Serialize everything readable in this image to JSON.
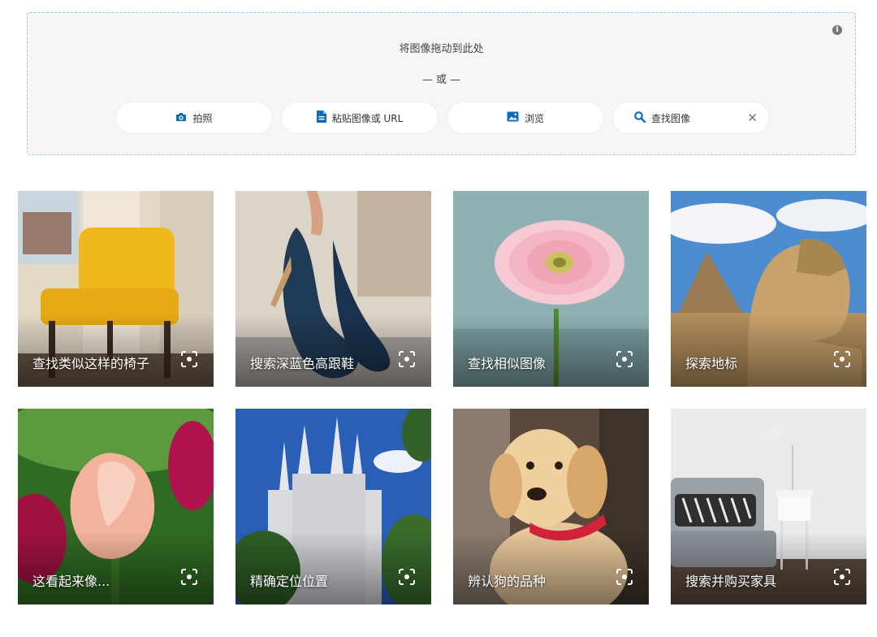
{
  "dropzone": {
    "title": "将图像拖动到此处",
    "or_text": "— 或 —",
    "buttons": {
      "camera": "拍照",
      "paste": "粘贴图像或 URL",
      "browse": "浏览",
      "search": "查找图像"
    },
    "close_glyph": "✕",
    "info_glyph": "i"
  },
  "examples": [
    {
      "caption": "查找类似这样的椅子"
    },
    {
      "caption": "搜索深蓝色高跟鞋"
    },
    {
      "caption": "查找相似图像"
    },
    {
      "caption": "探索地标"
    },
    {
      "caption": "这看起来像..."
    },
    {
      "caption": "精确定位位置"
    },
    {
      "caption": "辨认狗的品种"
    },
    {
      "caption": "搜索并购买家具"
    }
  ],
  "colors": {
    "accent": "#0f6cbd",
    "dropzone_border": "#9cc7e6",
    "dropzone_bg": "#f6f6f6"
  }
}
